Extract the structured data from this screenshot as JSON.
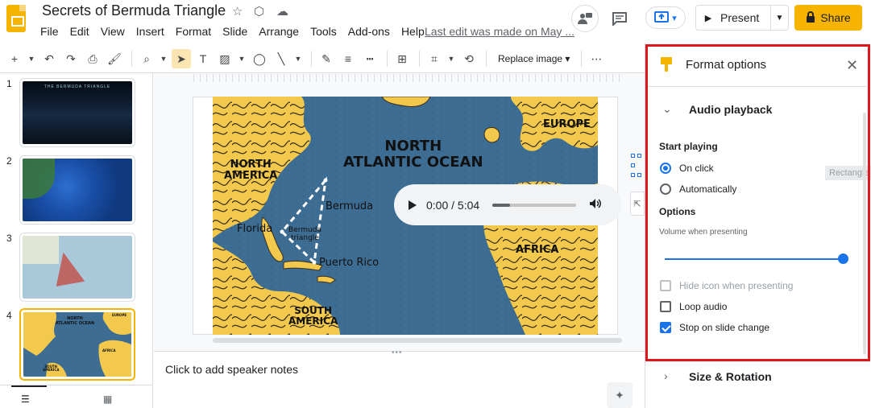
{
  "doc": {
    "title": "Secrets of Bermuda Triangle",
    "last_edit": "Last edit was made on May ..."
  },
  "menu": [
    "File",
    "Edit",
    "View",
    "Insert",
    "Format",
    "Slide",
    "Arrange",
    "Tools",
    "Add-ons",
    "Help"
  ],
  "header": {
    "present_label": "Present",
    "share_label": "Share"
  },
  "toolbar": {
    "replace_image_label": "Replace image"
  },
  "slides": [
    {
      "num": "1",
      "caption": "THE BERMUDA TRIANGLE"
    },
    {
      "num": "2"
    },
    {
      "num": "3"
    },
    {
      "num": "4"
    }
  ],
  "map_labels": {
    "north_america": "NORTH\nAMERICA",
    "ocean": "NORTH\nATLANTIC OCEAN",
    "europe": "EUROPE",
    "africa": "AFRICA",
    "south_america": "SOUTH\nAMERICA",
    "bermuda": "Bermuda",
    "florida": "Florida",
    "triangle": "Bermuda\ntriangle",
    "puerto_rico": "Puerto Rico"
  },
  "thumb4_labels": {
    "ocean": "NORTH\nATLANTIC OCEAN",
    "europe": "EUROPE",
    "africa": "AFRICA",
    "south_america": "SOUTH\nAMERICA"
  },
  "audio": {
    "time": "0:00 / 5:04",
    "progress": 0.0
  },
  "notes_placeholder": "Click to add speaker notes",
  "panel": {
    "title": "Format options",
    "audio_section": "Audio playback",
    "start_playing_label": "Start playing",
    "start_options": [
      {
        "label": "On click",
        "checked": true
      },
      {
        "label": "Automatically",
        "checked": false
      }
    ],
    "options_label": "Options",
    "volume_label": "Volume when presenting",
    "volume_level": 1.0,
    "checkboxes": [
      {
        "label": "Hide icon when presenting",
        "checked": false,
        "disabled": true
      },
      {
        "label": "Loop audio",
        "checked": false,
        "disabled": false
      },
      {
        "label": "Stop on slide change",
        "checked": true,
        "disabled": false
      }
    ],
    "size_section": "Size & Rotation",
    "tooltip": "Rectangle"
  },
  "colors": {
    "accent": "#1a73e8",
    "share": "#f6b400",
    "highlight": "#e0161e",
    "ocean": "#3d6d93",
    "land": "#f2c94c"
  }
}
